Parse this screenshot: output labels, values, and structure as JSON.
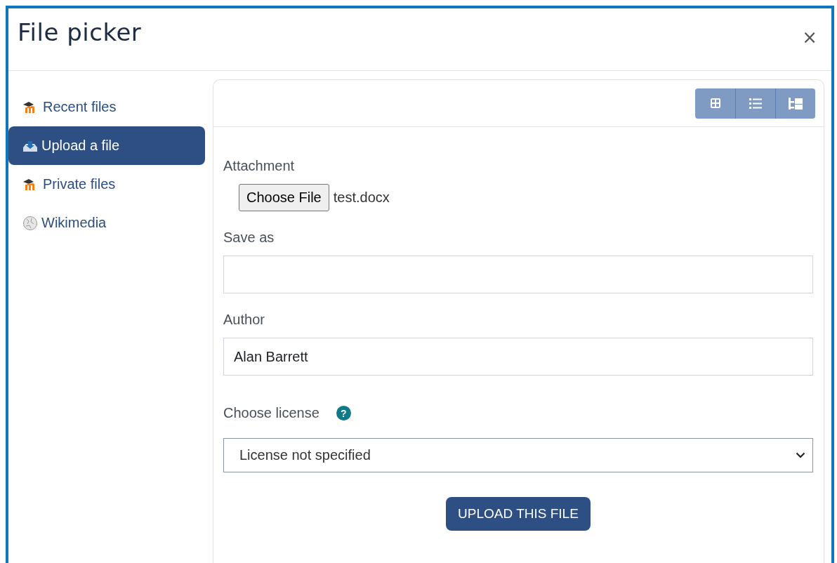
{
  "dialog": {
    "title": "File picker",
    "close": "×"
  },
  "sidebar": {
    "items": [
      {
        "label": "Recent files",
        "kind": "moodle",
        "selected": false
      },
      {
        "label": "Upload a file",
        "kind": "upload",
        "selected": true
      },
      {
        "label": "Private files",
        "kind": "moodle",
        "selected": false
      },
      {
        "label": "Wikimedia",
        "kind": "globe",
        "selected": false
      }
    ]
  },
  "view_buttons": [
    {
      "kind": "icons"
    },
    {
      "kind": "list"
    },
    {
      "kind": "tree"
    }
  ],
  "form": {
    "attachment": {
      "label": "Attachment",
      "button": "Choose File",
      "filename": "test.docx"
    },
    "save_as": {
      "label": "Save as"
    },
    "author": {
      "label": "Author",
      "value": "Alan Barrett"
    },
    "license": {
      "label": "Choose license",
      "help": "?",
      "value": "License not specified"
    },
    "submit": "UPLOAD THIS FILE"
  }
}
